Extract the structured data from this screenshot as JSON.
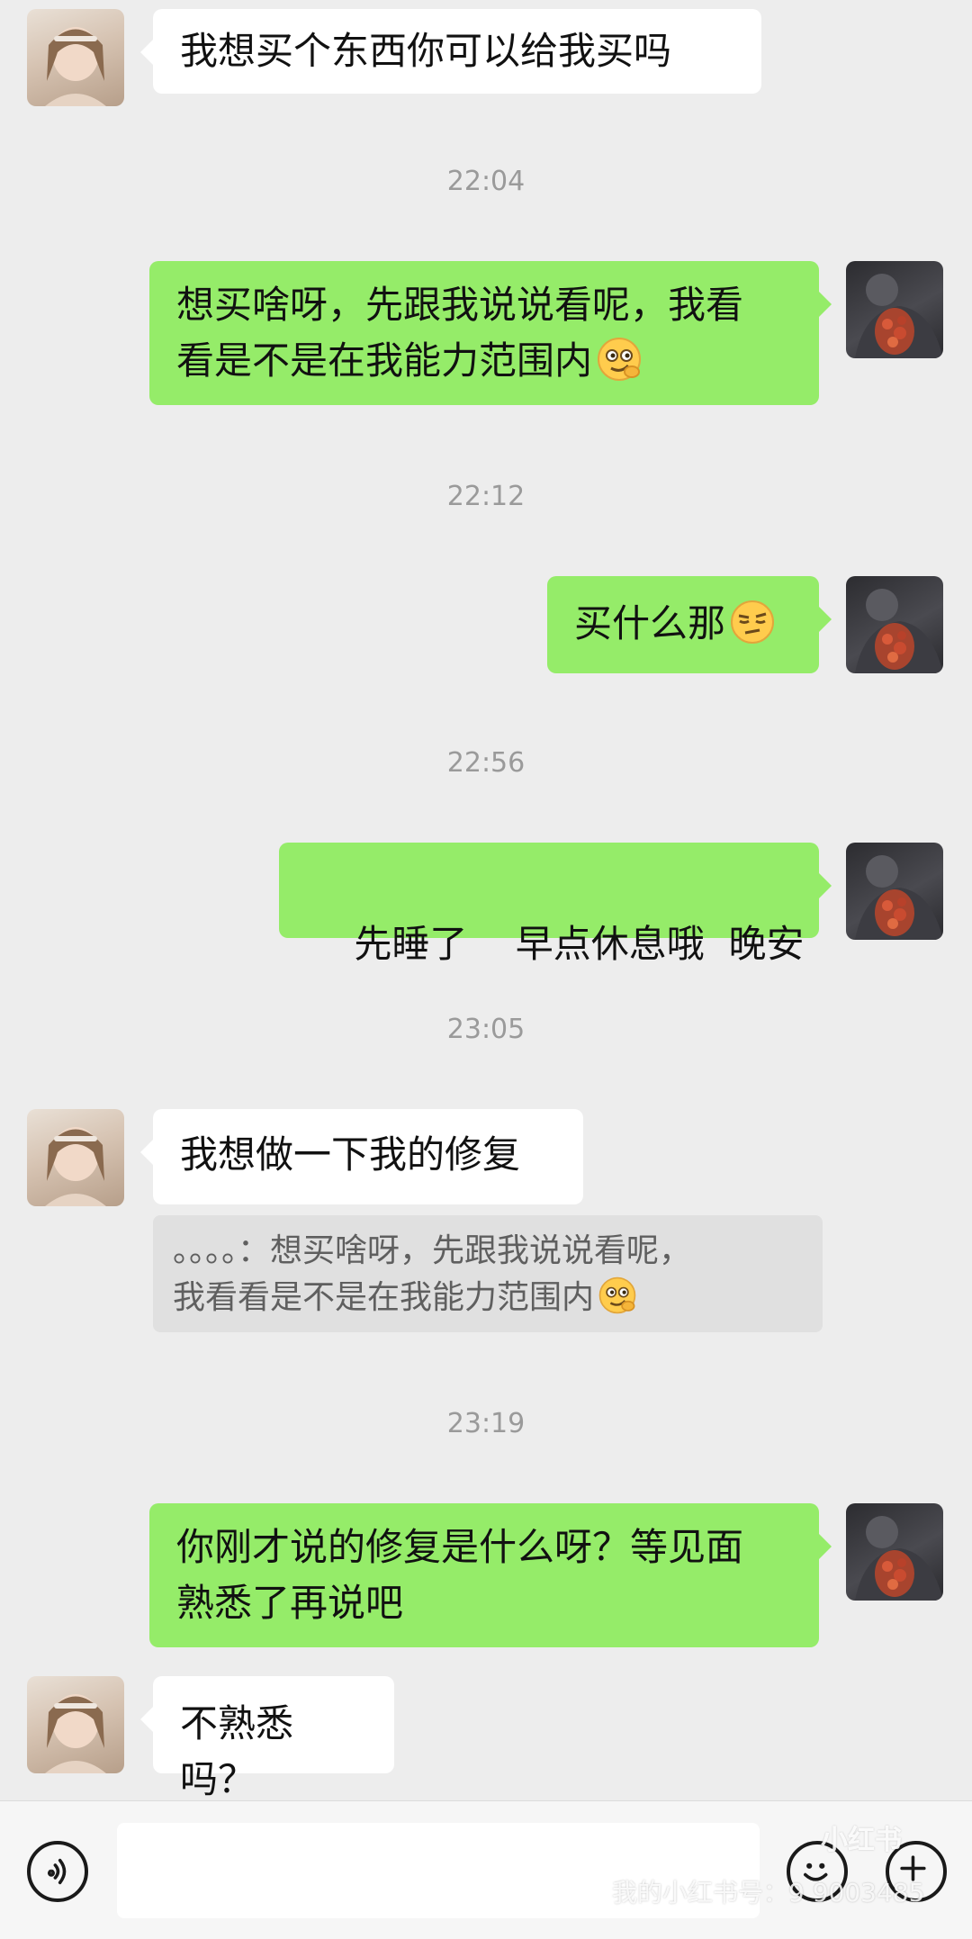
{
  "messages": [
    {
      "id": 1,
      "side": "left",
      "text": "我想买个东西你可以给我买吗"
    },
    {
      "id": 2,
      "time": "22:04"
    },
    {
      "id": 3,
      "side": "right",
      "text_line1": "想买啥呀，先跟我说说看呢，我看",
      "text_line2": "看是不是在我能力范围内",
      "emoji": "smirk-emoji"
    },
    {
      "id": 4,
      "time": "22:12"
    },
    {
      "id": 5,
      "side": "right",
      "text": "买什么那",
      "emoji": "doubtful-emoji"
    },
    {
      "id": 6,
      "time": "22:56"
    },
    {
      "id": 7,
      "side": "right",
      "text": "先睡了    早点休息哦  晚安"
    },
    {
      "id": 8,
      "time": "23:05"
    },
    {
      "id": 9,
      "side": "left",
      "text": "我想做一下我的修复"
    },
    {
      "id": 10,
      "quote_line1": "。。。。：想买啥呀，先跟我说说看呢，",
      "quote_line2": "我看看是不是在我能力范围内",
      "emoji": "smirk-emoji"
    },
    {
      "id": 11,
      "time": "23:19"
    },
    {
      "id": 12,
      "side": "right",
      "text_line1": "你刚才说的修复是什么呀？等见面",
      "text_line2": "熟悉了再说吧"
    },
    {
      "id": 13,
      "side": "left",
      "text": "不熟悉吗？"
    }
  ],
  "bottom_bar": {
    "voice_icon": "voice-icon",
    "emoji_icon": "emoji-icon",
    "plus_icon": "plus-icon",
    "watermark_text": "我的小红书号：9 9003485",
    "watermark_logo": "小红书"
  },
  "colors": {
    "background": "#ededed",
    "bubble_right": "#95ec69",
    "bubble_left": "#ffffff",
    "timestamp": "#9a9a9a"
  }
}
